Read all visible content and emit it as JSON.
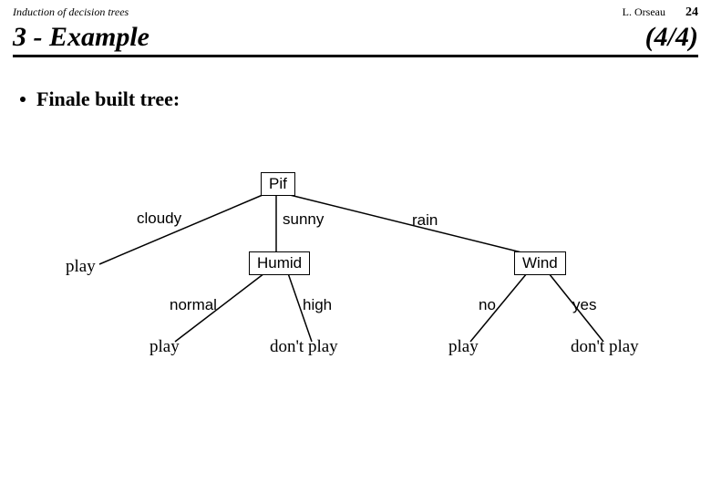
{
  "header": {
    "course": "Induction of decision trees",
    "author": "L. Orseau",
    "page_number": "24"
  },
  "title": {
    "section": "3 - Example",
    "progress": "(4/4)"
  },
  "bullet": {
    "text": "Finale built tree:"
  },
  "tree": {
    "root": {
      "label": "Pif"
    },
    "root_edges": {
      "left": "cloudy",
      "mid": "sunny",
      "right": "rain"
    },
    "left_leaf": "play",
    "mid_node": {
      "label": "Humid"
    },
    "mid_edges": {
      "left": "normal",
      "right": "high"
    },
    "mid_left_leaf": "play",
    "mid_right_leaf": "don't play",
    "right_node": {
      "label": "Wind"
    },
    "right_edges": {
      "left": "no",
      "right": "yes"
    },
    "right_left_leaf": "play",
    "right_right_leaf": "don't play"
  }
}
